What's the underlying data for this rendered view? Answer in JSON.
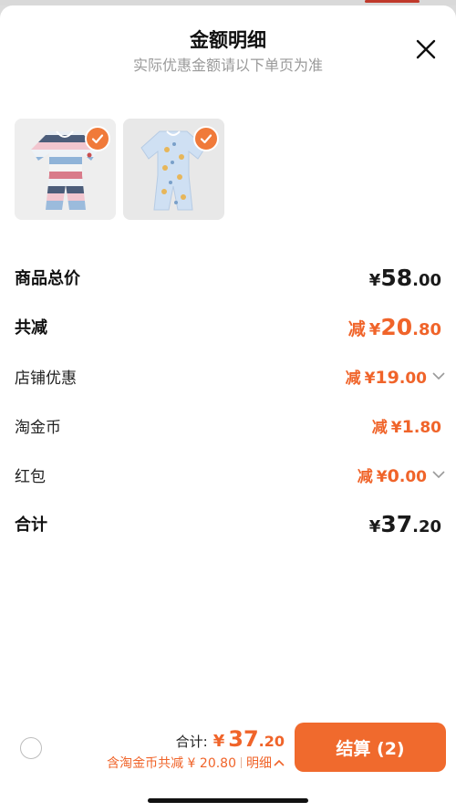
{
  "header": {
    "title": "金额明细",
    "subtitle": "实际优惠金额请以下单页为准"
  },
  "products": [
    {
      "name": "striped-baby-romper",
      "selected": true
    },
    {
      "name": "blue-printed-baby-romper",
      "selected": true
    }
  ],
  "summary": {
    "goods_total": {
      "label": "商品总价",
      "yen": "¥",
      "int": "58",
      "dec": ".00"
    },
    "total_discount": {
      "label": "共减",
      "prefix": "减",
      "yen": "¥",
      "int": "20",
      "dec": ".80"
    },
    "shop_discount": {
      "label": "店铺优惠",
      "prefix": "减",
      "yen": "¥",
      "int": "19",
      "dec": ".00"
    },
    "taojinbi": {
      "label": "淘金币",
      "prefix": "减",
      "yen": "¥",
      "int": "1",
      "dec": ".80"
    },
    "hongbao": {
      "label": "红包",
      "prefix": "减",
      "yen": "¥",
      "int": "0",
      "dec": ".00"
    },
    "total": {
      "label": "合计",
      "yen": "¥",
      "int": "37",
      "dec": ".20"
    }
  },
  "bottom_bar": {
    "total_label": "合计:",
    "yen": "¥",
    "total_int": "37",
    "total_dec": ".20",
    "discount_text": "含淘金币共减 ¥ 20.80",
    "detail_label": "明细",
    "checkout_label": "结算 (2)"
  },
  "colors": {
    "accent": "#f06a2d",
    "price_orange": "#f0642a",
    "subtitle_gray": "#9a9a9a"
  },
  "icons": {
    "close": "close-icon",
    "check": "check-icon",
    "chevron_down": "chevron-down-icon",
    "chevron_up": "chevron-up-icon"
  }
}
